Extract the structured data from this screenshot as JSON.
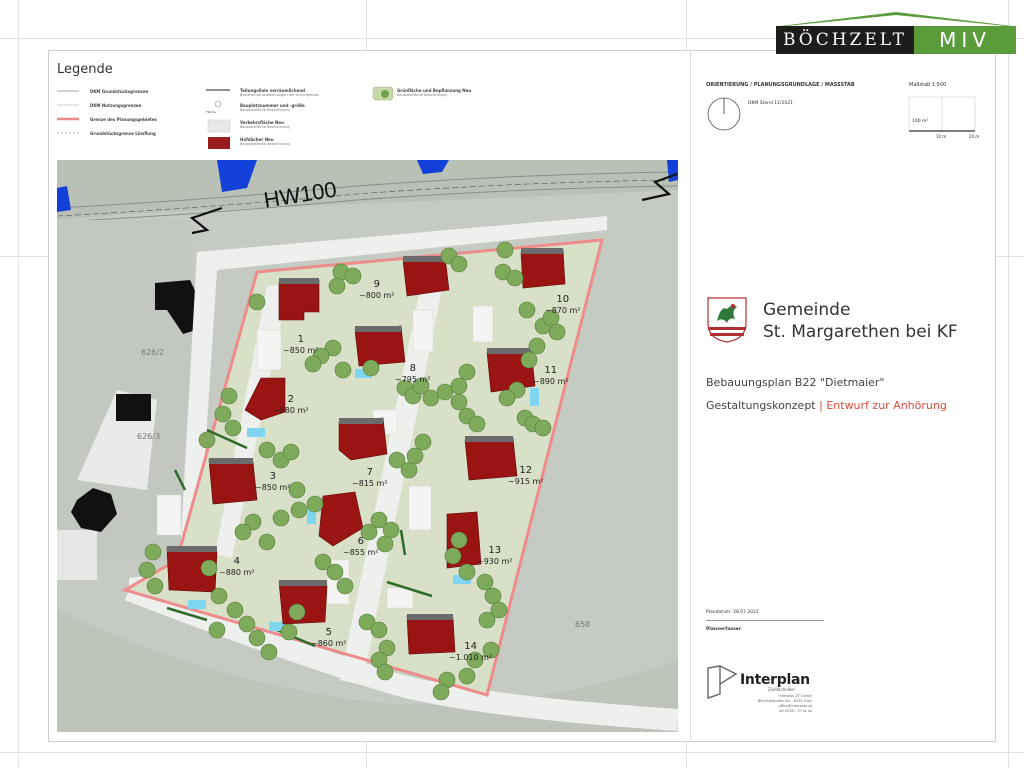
{
  "brand": {
    "name": "BÖCHZELT",
    "suffix": "MIV"
  },
  "legend": {
    "title": "Legende",
    "col1": [
      {
        "title": "DKM Grundstücksgrenzen",
        "sub": ""
      },
      {
        "title": "DKM Nutzungsgrenzen",
        "sub": ""
      },
      {
        "title": "Grenze des Planungsgebietes",
        "sub": ""
      },
      {
        "title": "Grundstücksgrenze Linsflung",
        "sub": ""
      }
    ],
    "col2": [
      {
        "title": "Teilungslinie verräumlichend",
        "sub": "Bestehende Abweichungen der Grundgrenze"
      },
      {
        "title": "Bauplatznummer und -größe",
        "sub": "Bauplatzfläche Bezeichnung"
      },
      {
        "title": "Verkehrsfläche Neu",
        "sub": "Bauplatzfläche Bezeichnung"
      },
      {
        "title": "Hofdächer Neu",
        "sub": "Bauplatzfläche Bezeichnung"
      }
    ],
    "col3": [
      {
        "title": "Grünfläche und Bepflanzung Neu",
        "sub": "Bauplatzfläche Bezeichnung"
      }
    ],
    "sym_label": "Fläche"
  },
  "header": {
    "orientation": "ORIENTIERUNG / PLANUNGSGRUNDLAGE / MASSSTAB",
    "scale": "Maßstab 1:500",
    "dkm": "DKM Stand 11/2021",
    "scale_area": "100 m²",
    "scale_10": "10 m",
    "scale_20": "20 m"
  },
  "gemeinde": {
    "line1": "Gemeinde",
    "line2": "St. Margarethen bei KF"
  },
  "bebauungsplan": "Bebauungsplan B22 \"Dietmaier\"",
  "konzept": {
    "label": "Gestaltungskonzept",
    "sep": " | ",
    "status": "Entwurf zur Anhörung"
  },
  "plandatum": "Plandatum: 28.07.2022",
  "planverfasser": "Planverfasser",
  "interplan": {
    "name": "Interplan",
    "sub": "Ziviltechniker",
    "address": [
      "Interplan ZT GmbH",
      "Bahnhofstraße 0/4 - 8330 Graz",
      "office@interplan.at",
      "tel 0316 / 70 xx xx"
    ]
  },
  "map": {
    "flood_label": "HW100",
    "parcels": [
      "626/2",
      "626/3",
      "658"
    ],
    "lots": [
      {
        "n": "1",
        "area": "~850 m²"
      },
      {
        "n": "2",
        "area": "~880 m²"
      },
      {
        "n": "3",
        "area": "~850 m²"
      },
      {
        "n": "4",
        "area": "~880 m²"
      },
      {
        "n": "5",
        "area": "~860 m²"
      },
      {
        "n": "6",
        "area": "~855 m²"
      },
      {
        "n": "7",
        "area": "~815 m²"
      },
      {
        "n": "8",
        "area": "~795 m²"
      },
      {
        "n": "9",
        "area": "~800 m²"
      },
      {
        "n": "10",
        "area": "~870 m²"
      },
      {
        "n": "11",
        "area": "~890 m²"
      },
      {
        "n": "12",
        "area": "~915 m²"
      },
      {
        "n": "13",
        "area": "~930 m²"
      },
      {
        "n": "14",
        "area": "~1.010 m²"
      }
    ]
  }
}
